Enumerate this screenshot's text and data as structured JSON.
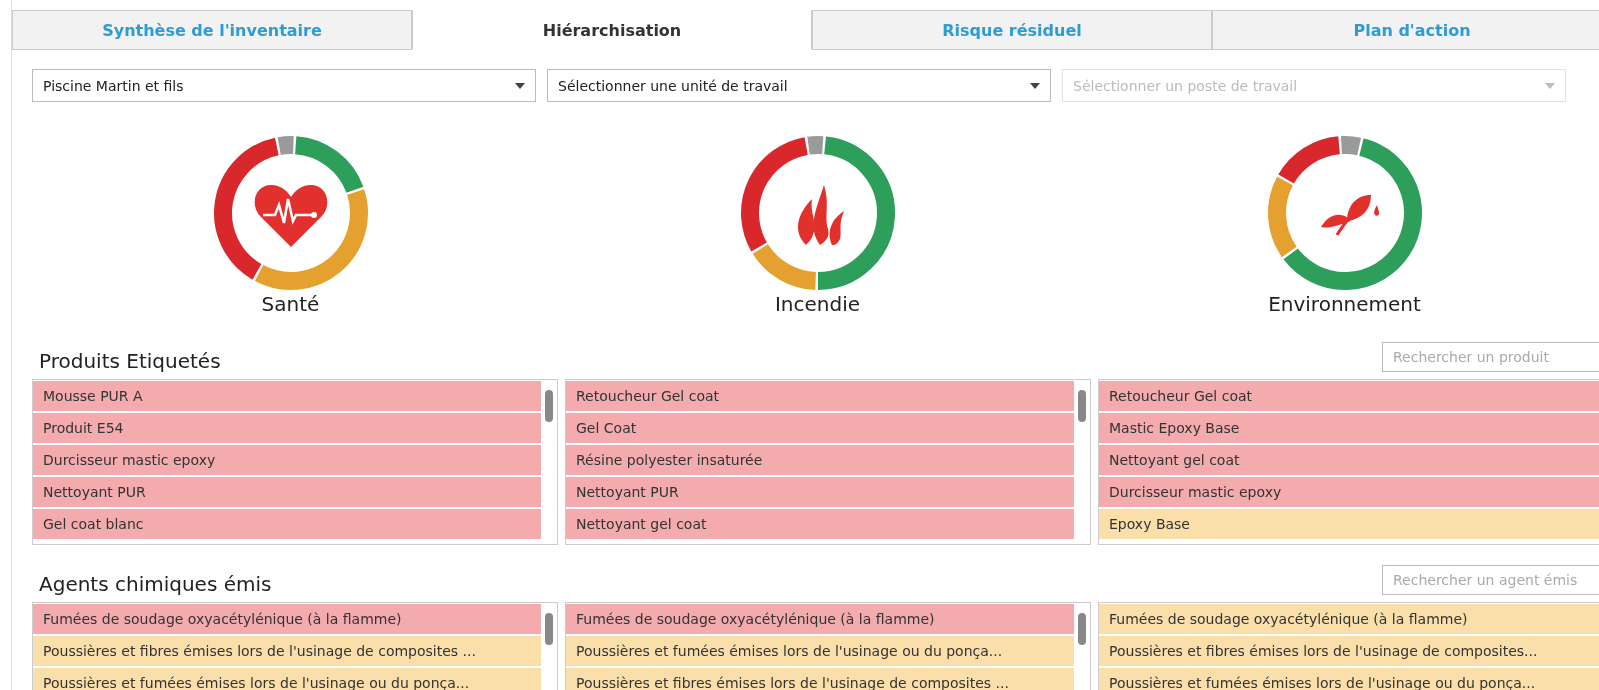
{
  "tabs": [
    {
      "label": "Synthèse de l'inventaire",
      "selected": false
    },
    {
      "label": "Hiérarchisation",
      "selected": true
    },
    {
      "label": "Risque résiduel",
      "selected": false
    },
    {
      "label": "Plan d'action",
      "selected": false
    }
  ],
  "filters": [
    {
      "value": "Piscine Martin et fils",
      "disabled": false
    },
    {
      "value": "Sélectionner une unité de travail",
      "disabled": false
    },
    {
      "placeholder": "Sélectionner un poste de travail",
      "disabled": true
    }
  ],
  "gauges": [
    {
      "kind": "health",
      "label": "Santé"
    },
    {
      "kind": "fire",
      "label": "Incendie"
    },
    {
      "kind": "environment",
      "label": "Environnement"
    }
  ],
  "sections": [
    {
      "title": "Produits Etiquetés",
      "search": {
        "placeholder": "Rechercher un produit"
      },
      "lists": [
        {
          "scrollbar": true,
          "items": [
            {
              "text": "Mousse PUR A",
              "color": "#f4abad"
            },
            {
              "text": "Produit E54",
              "color": "#f4abad"
            },
            {
              "text": "Durcisseur mastic epoxy",
              "color": "#f4abad"
            },
            {
              "text": "Nettoyant PUR",
              "color": "#f4abad"
            },
            {
              "text": "Gel coat blanc",
              "color": "#f4abad"
            }
          ]
        },
        {
          "scrollbar": true,
          "items": [
            {
              "text": "Retoucheur Gel coat",
              "color": "#f4abad"
            },
            {
              "text": "Gel Coat",
              "color": "#f4abad"
            },
            {
              "text": "Résine polyester insaturée",
              "color": "#f4abad"
            },
            {
              "text": "Nettoyant PUR",
              "color": "#f4abad"
            },
            {
              "text": "Nettoyant gel coat",
              "color": "#f4abad"
            }
          ]
        },
        {
          "items": [
            {
              "text": "Retoucheur Gel coat",
              "color": "#f4abad"
            },
            {
              "text": "Mastic Epoxy Base",
              "color": "#f4abad"
            },
            {
              "text": "Nettoyant gel coat",
              "color": "#f4abad"
            },
            {
              "text": "Durcisseur mastic epoxy",
              "color": "#f4abad"
            },
            {
              "text": "Epoxy Base",
              "color": "#fadfab"
            }
          ]
        }
      ]
    },
    {
      "title": "Agents chimiques émis",
      "search": {
        "placeholder": "Rechercher un agent émis"
      },
      "lists": [
        {
          "scrollbar": true,
          "items": [
            {
              "text": "Fumées de soudage oxyacétylénique (à la flamme)",
              "color": "#f4abad"
            },
            {
              "text": "Poussières et fibres émises lors de l'usinage de composites ...",
              "color": "#fadfab"
            },
            {
              "text": "Poussières et fumées émises lors de l'usinage ou du ponça...",
              "color": "#fadfab"
            }
          ]
        },
        {
          "scrollbar": true,
          "items": [
            {
              "text": "Fumées de soudage oxyacétylénique (à la flamme)",
              "color": "#f4abad"
            },
            {
              "text": "Poussières et fumées émises lors de l'usinage ou du ponça...",
              "color": "#fadfab"
            },
            {
              "text": "Poussières et fibres émises lors de l'usinage de composites ...",
              "color": "#fadfab"
            }
          ]
        },
        {
          "items": [
            {
              "text": "Fumées de soudage oxyacétylénique (à la flamme)",
              "color": "#fadfab"
            },
            {
              "text": "Poussières et fibres émises lors de l'usinage de composites...",
              "color": "#fadfab"
            },
            {
              "text": "Poussières et fumées émises lors de l'usinage ou du ponça...",
              "color": "#fadfab"
            }
          ]
        }
      ]
    }
  ]
}
